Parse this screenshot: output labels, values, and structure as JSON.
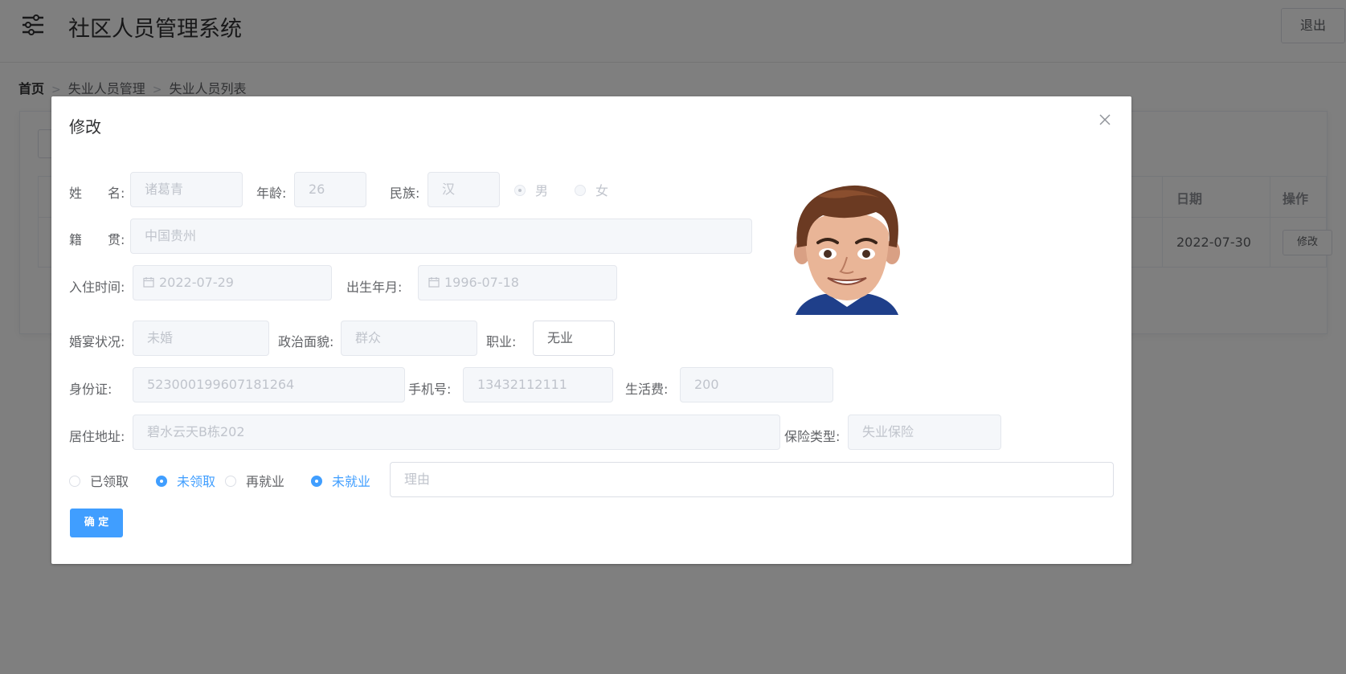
{
  "app": {
    "title": "社区人员管理系统",
    "logout_label": "退出"
  },
  "breadcrumb": {
    "items": [
      "首页",
      "失业人员管理",
      "失业人员列表"
    ]
  },
  "table": {
    "headers": {
      "date": "日期",
      "action": "操作"
    },
    "rows": [
      {
        "date": "2022-07-30",
        "action_label": "修改"
      }
    ]
  },
  "dialog": {
    "title": "修改",
    "fields": {
      "name": {
        "label": "姓　　名:",
        "value": "诸葛青"
      },
      "age": {
        "label": "年龄:",
        "value": "26"
      },
      "ethnicity": {
        "label": "民族:",
        "value": "汉"
      },
      "gender": {
        "options": [
          "男",
          "女"
        ],
        "selected": "男"
      },
      "native_place": {
        "label": "籍　　贯:",
        "value": "中国贵州"
      },
      "move_in_date": {
        "label": "入住时间:",
        "value": "2022-07-29"
      },
      "birth_date": {
        "label": "出生年月:",
        "value": "1996-07-18"
      },
      "marital_status": {
        "label": "婚宴状况:",
        "value": "未婚"
      },
      "political_status": {
        "label": "政治面貌:",
        "value": "群众"
      },
      "occupation": {
        "label": "职业:",
        "value": "无业"
      },
      "id_card": {
        "label": "身份证:",
        "value": "523000199607181264"
      },
      "phone": {
        "label": "手机号:",
        "value": "13432112111"
      },
      "living_expense": {
        "label": "生活费:",
        "value": "200"
      },
      "address": {
        "label": "居住地址:",
        "value": "碧水云天B栋202"
      },
      "insurance_type": {
        "label": "保险类型:",
        "value": "失业保险"
      },
      "receive_status": {
        "options": [
          "已领取",
          "未领取"
        ],
        "selected": "未领取"
      },
      "employment_status": {
        "options": [
          "再就业",
          "未就业"
        ],
        "selected": "未就业"
      },
      "reason": {
        "placeholder": "理由"
      }
    },
    "confirm_label": "确 定"
  },
  "colors": {
    "primary": "#409eff",
    "mask": "rgba(0,0,0,0.5)"
  }
}
